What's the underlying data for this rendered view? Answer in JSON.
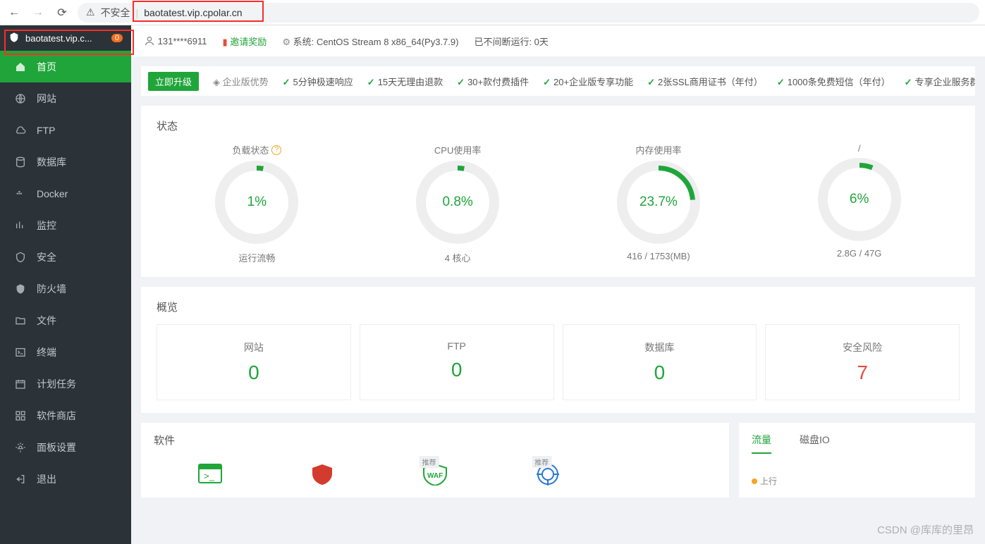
{
  "browser": {
    "url": "baotatest.vip.cpolar.cn",
    "insecure_label": "不安全",
    "tab_title": "baotatest.vip.c...",
    "tab_badge": "0"
  },
  "sidebar": {
    "items": [
      {
        "label": "首页"
      },
      {
        "label": "网站"
      },
      {
        "label": "FTP"
      },
      {
        "label": "数据库"
      },
      {
        "label": "Docker"
      },
      {
        "label": "监控"
      },
      {
        "label": "安全"
      },
      {
        "label": "防火墙"
      },
      {
        "label": "文件"
      },
      {
        "label": "终端"
      },
      {
        "label": "计划任务"
      },
      {
        "label": "软件商店"
      },
      {
        "label": "面板设置"
      },
      {
        "label": "退出"
      }
    ]
  },
  "topline": {
    "user": "131****6911",
    "invite": "邀请奖励",
    "sys_label": "系统:",
    "sys_value": "CentOS Stream 8 x86_64(Py3.7.9)",
    "uptime": "已不间断运行: 0天"
  },
  "promo": {
    "upgrade": "立即升级",
    "enterprise": "企业版优势",
    "features": [
      "5分钟极速响应",
      "15天无理由退款",
      "30+款付费插件",
      "20+企业版专享功能",
      "2张SSL商用证书（年付）",
      "1000条免费短信（年付）",
      "专享企业服务群"
    ]
  },
  "status": {
    "title": "状态",
    "gauges": [
      {
        "head": "负载状态",
        "value": "1%",
        "sub": "运行流畅",
        "help": true,
        "arc": 3
      },
      {
        "head": "CPU使用率",
        "value": "0.8%",
        "sub": "4 核心",
        "arc": 3
      },
      {
        "head": "内存使用率",
        "value": "23.7%",
        "sub": "416 / 1753(MB)",
        "arc": 24
      },
      {
        "head": "/",
        "value": "6%",
        "sub": "2.8G / 47G",
        "arc": 6
      }
    ]
  },
  "overview": {
    "title": "概览",
    "items": [
      {
        "label": "网站",
        "value": "0",
        "cls": "green"
      },
      {
        "label": "FTP",
        "value": "0",
        "cls": "green"
      },
      {
        "label": "数据库",
        "value": "0",
        "cls": "green"
      },
      {
        "label": "安全风险",
        "value": "7",
        "cls": "red"
      }
    ]
  },
  "software": {
    "title": "软件",
    "rec": "推荐"
  },
  "traffic": {
    "tab1": "流量",
    "tab2": "磁盘IO",
    "legend_up": "上行"
  },
  "watermark": "CSDN @库库的里昂"
}
